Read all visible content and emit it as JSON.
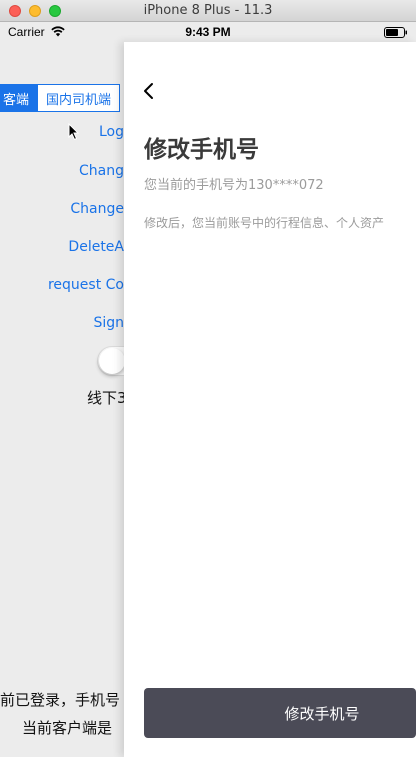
{
  "window": {
    "title": "iPhone 8 Plus - 11.3"
  },
  "statusbar": {
    "carrier": "Carrier",
    "time": "9:43 PM"
  },
  "background_screen": {
    "segments": [
      {
        "label": "客端",
        "selected": true
      },
      {
        "label": "国内司机端",
        "selected": false
      }
    ],
    "buttons": [
      {
        "label": "Log"
      },
      {
        "label": "Chang"
      },
      {
        "label": "Change"
      },
      {
        "label": "DeleteA"
      },
      {
        "label": "request Co"
      },
      {
        "label": "Sign"
      }
    ],
    "toggle": {
      "label": "线下3"
    },
    "bottom": {
      "line1": "前已登录，手机号",
      "line2": "当前客户端是"
    }
  },
  "sheet": {
    "title": "修改手机号",
    "current_phone": "您当前的手机号为130****072",
    "notice": "修改后，您当前账号中的行程信息、个人资产",
    "primary_button": "修改手机号"
  },
  "colors": {
    "accent": "#1a73e8",
    "button_bg": "#4b4b57",
    "muted_text": "#9b9b9b"
  }
}
